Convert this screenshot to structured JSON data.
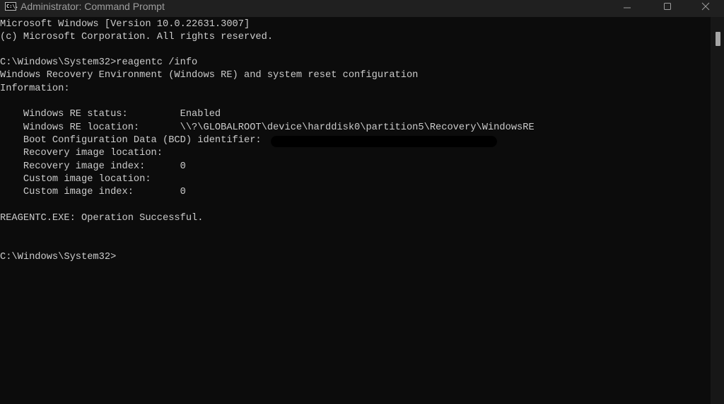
{
  "window": {
    "title": "Administrator: Command Prompt",
    "icon": "cmd-icon",
    "icon_text": "C:\\.",
    "controls": [
      "minimize",
      "maximize",
      "close"
    ]
  },
  "console": {
    "lines": [
      "Microsoft Windows [Version 10.0.22631.3007]",
      "(c) Microsoft Corporation. All rights reserved.",
      "",
      "C:\\Windows\\System32>reagentc /info",
      "Windows Recovery Environment (Windows RE) and system reset configuration",
      "Information:",
      "",
      "    Windows RE status:         Enabled",
      "    Windows RE location:       \\\\?\\GLOBALROOT\\device\\harddisk0\\partition5\\Recovery\\WindowsRE",
      "    Boot Configuration Data (BCD) identifier: ",
      "    Recovery image location:",
      "    Recovery image index:      0",
      "    Custom image location:",
      "    Custom image index:        0",
      "",
      "REAGENTC.EXE: Operation Successful.",
      "",
      "",
      "C:\\Windows\\System32>"
    ],
    "redacted_field": "Boot Configuration Data (BCD) identifier"
  }
}
